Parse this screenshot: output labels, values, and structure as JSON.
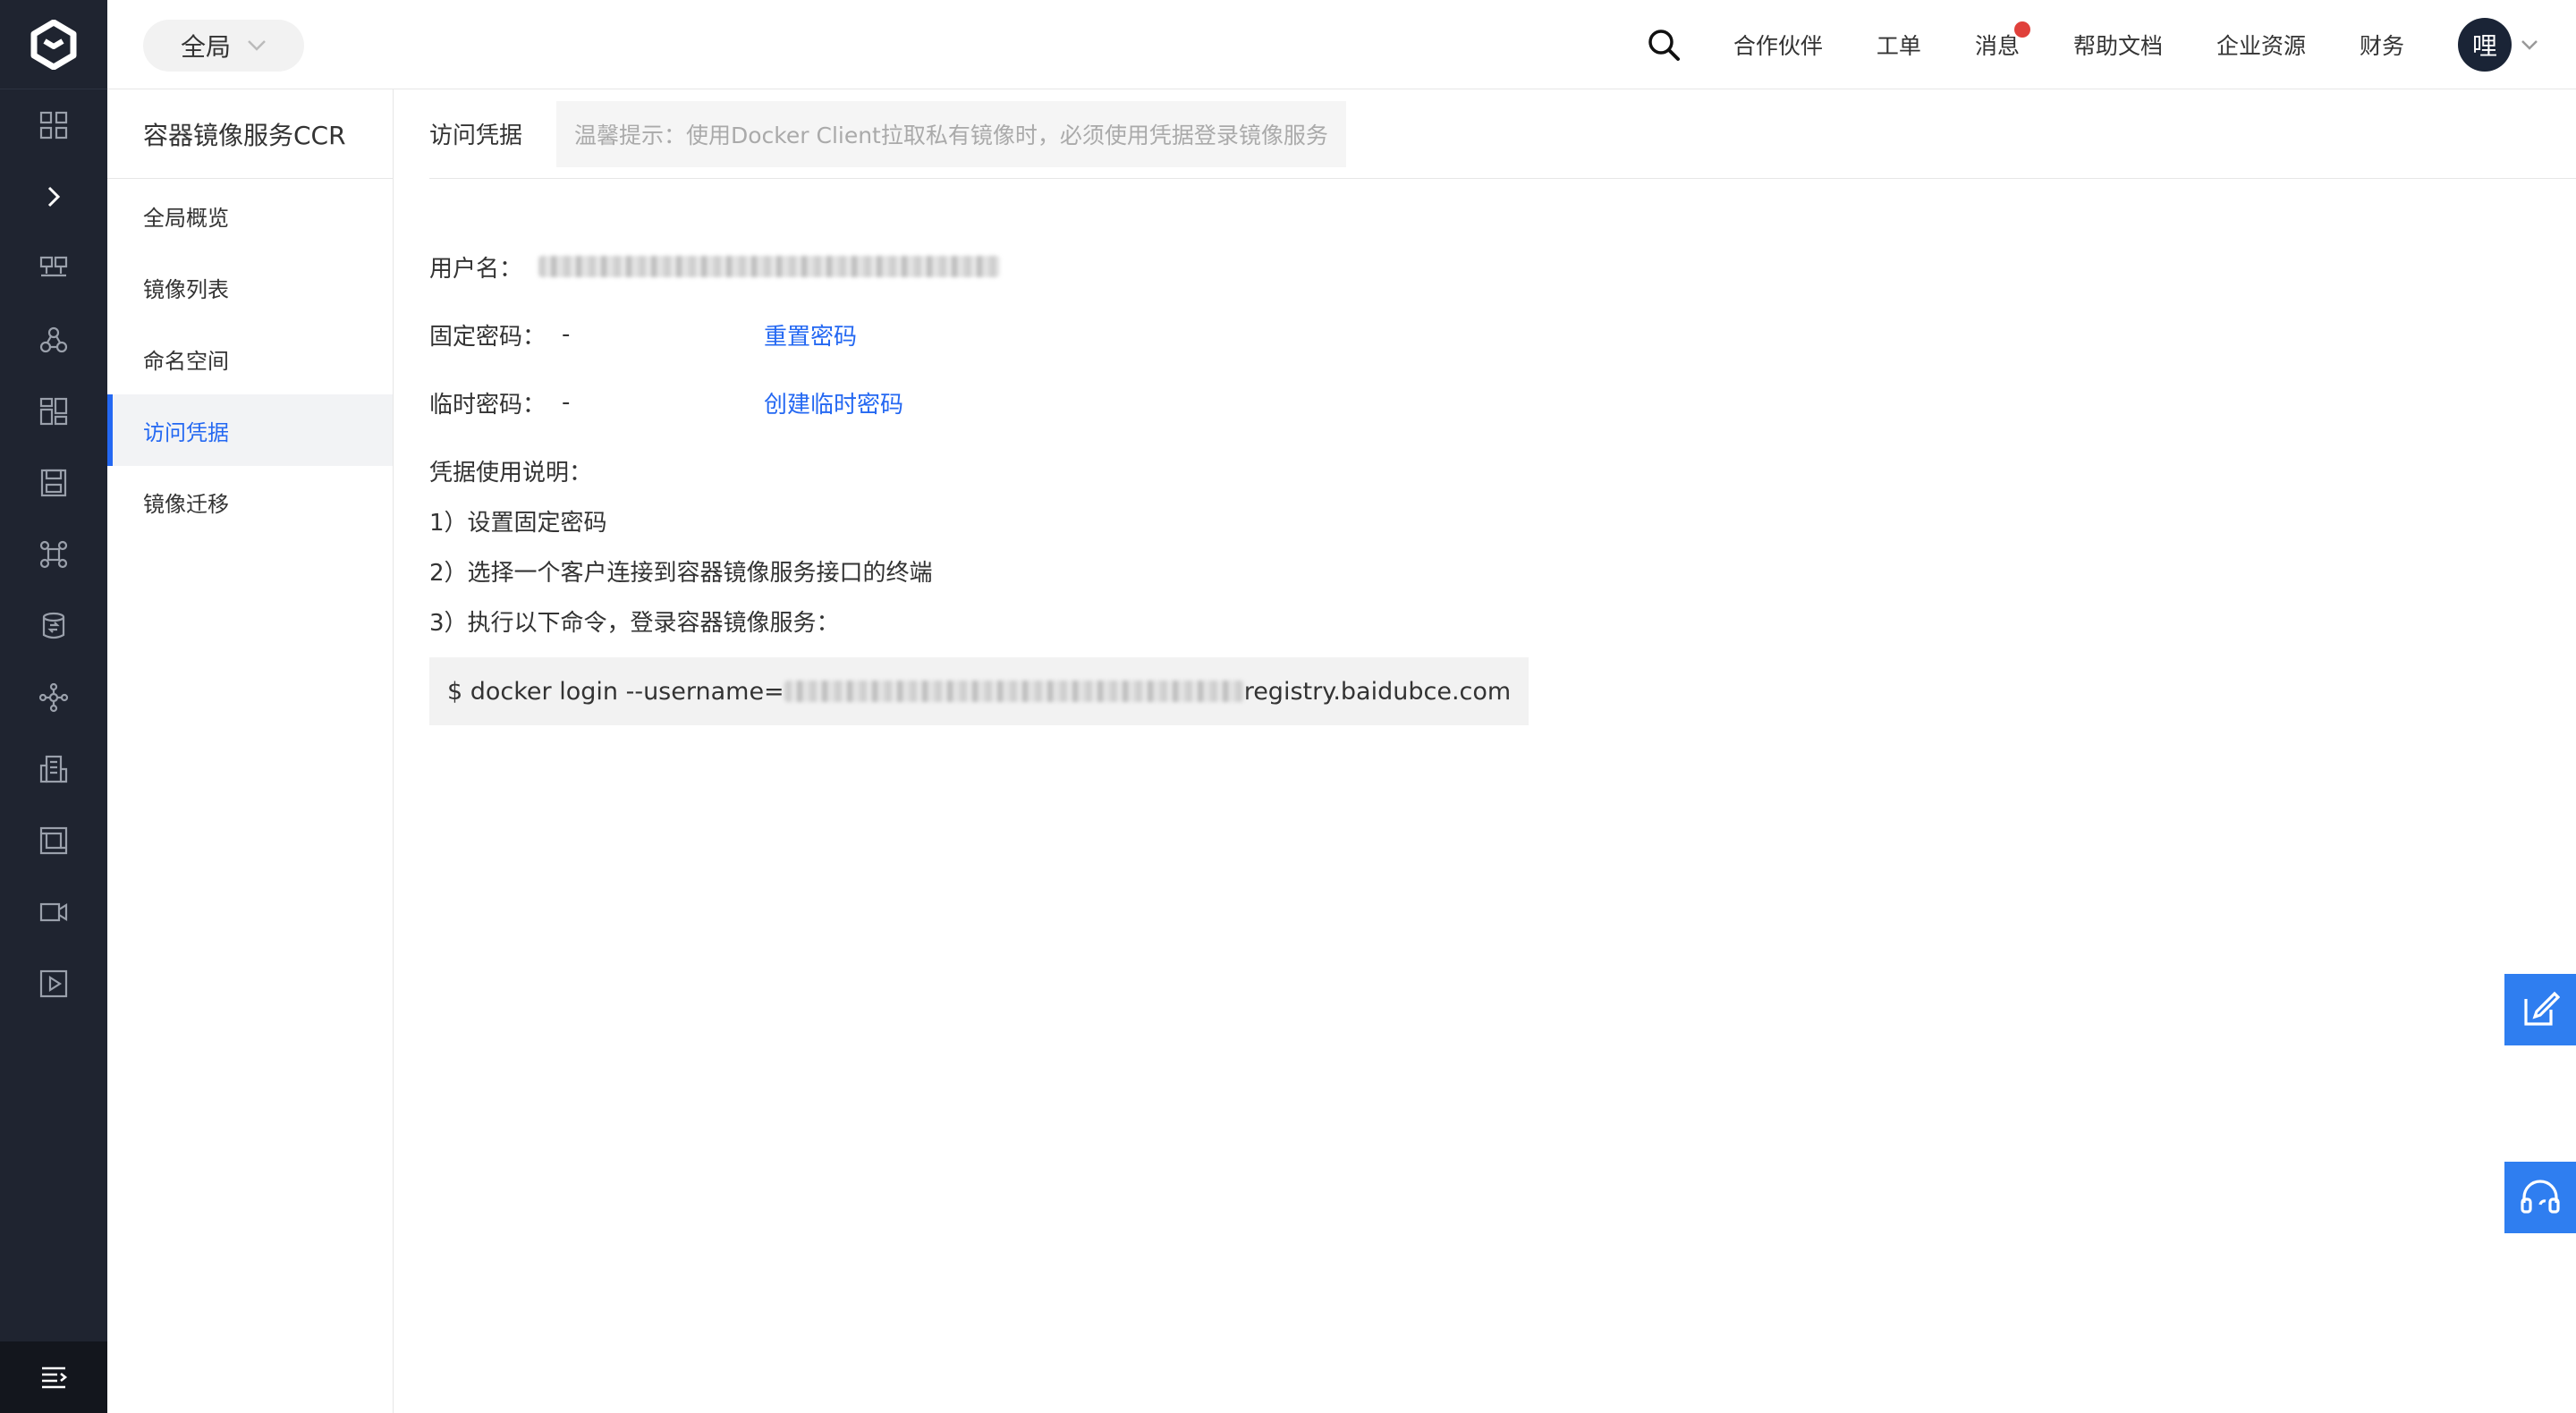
{
  "app": {
    "region_label": "全局",
    "service_title": "容器镜像服务CCR"
  },
  "topnav": {
    "items": [
      "合作伙伴",
      "工单",
      "消息",
      "帮助文档",
      "企业资源",
      "财务"
    ],
    "avatar_text": "哩"
  },
  "sidebar": {
    "items": [
      {
        "label": "全局概览",
        "active": false
      },
      {
        "label": "镜像列表",
        "active": false
      },
      {
        "label": "命名空间",
        "active": false
      },
      {
        "label": "访问凭据",
        "active": true
      },
      {
        "label": "镜像迁移",
        "active": false
      }
    ]
  },
  "page": {
    "title": "访问凭据",
    "tip": "温馨提示：使用Docker Client拉取私有镜像时，必须使用凭据登录镜像服务"
  },
  "credentials": {
    "username_label": "用户名：",
    "fixed_password_label": "固定密码：",
    "fixed_password_value": "-",
    "reset_password_link": "重置密码",
    "temp_password_label": "临时密码：",
    "temp_password_value": "-",
    "create_temp_password_link": "创建临时密码"
  },
  "instructions": {
    "heading": "凭据使用说明：",
    "steps": [
      "1）设置固定密码",
      "2）选择一个客户连接到容器镜像服务接口的终端",
      "3）执行以下命令，登录容器镜像服务："
    ]
  },
  "command": {
    "prefix": "$ docker login --username=",
    "suffix": " registry.baidubce.com"
  },
  "colors": {
    "accent": "#2468f2",
    "rail_bg": "#1f2430",
    "badge": "#e0403b",
    "float_button": "#2f7ef0"
  }
}
